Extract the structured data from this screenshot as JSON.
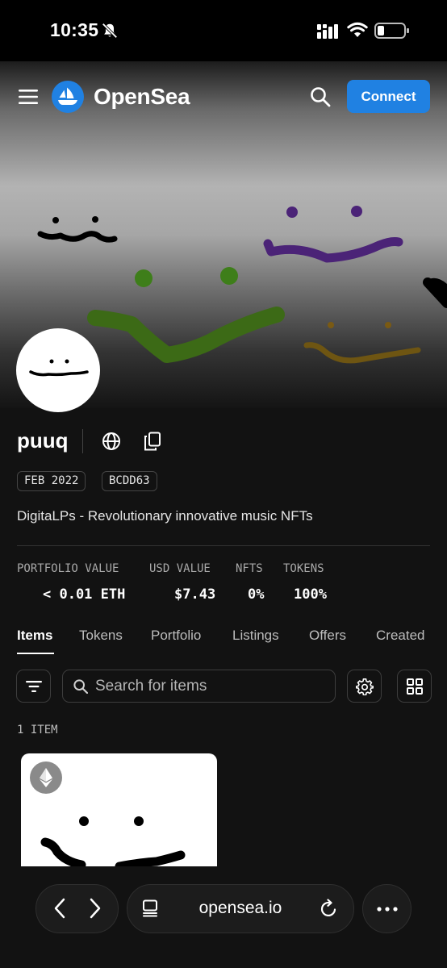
{
  "status_bar": {
    "time": "10:35"
  },
  "header": {
    "logo_text": "OpenSea",
    "connect_label": "Connect"
  },
  "profile": {
    "name": "puuq",
    "tags": [
      "FEB 2022",
      "BCDD63"
    ],
    "bio": "DigitaLPs - Revolutionary innovative music NFTs"
  },
  "stats": [
    {
      "label": "PORTFOLIO VALUE",
      "value": "< 0.01 ETH"
    },
    {
      "label": "USD VALUE",
      "value": "$7.43"
    },
    {
      "label": "NFTS",
      "value": "0%"
    },
    {
      "label": "TOKENS",
      "value": "100%"
    }
  ],
  "tabs": [
    {
      "label": "Items",
      "active": true
    },
    {
      "label": "Tokens"
    },
    {
      "label": "Portfolio"
    },
    {
      "label": "Listings"
    },
    {
      "label": "Offers"
    },
    {
      "label": "Created"
    }
  ],
  "search": {
    "placeholder": "Search for items"
  },
  "items": {
    "count_label": "1 ITEM"
  },
  "browser": {
    "url": "opensea.io"
  },
  "colors": {
    "accent": "#2081e2",
    "background": "#121212"
  }
}
